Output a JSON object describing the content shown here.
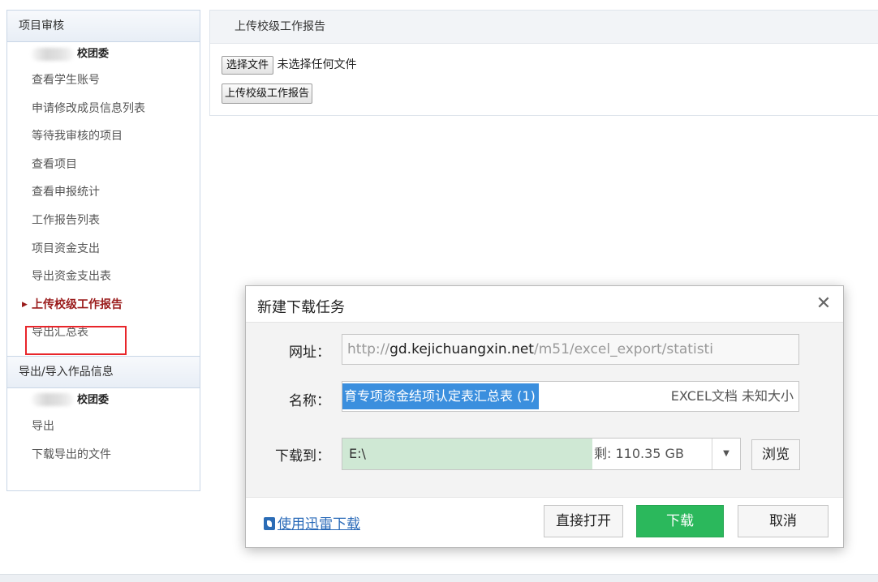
{
  "sidebar": {
    "section1_title": "项目审核",
    "org1_suffix": "校团委",
    "items": [
      "查看学生账号",
      "申请修改成员信息列表",
      "等待我审核的项目",
      "查看项目",
      "查看申报统计",
      "工作报告列表",
      "项目资金支出",
      "导出资金支出表",
      "上传校级工作报告",
      "导出汇总表"
    ],
    "active_arrow": "▶",
    "section2_title": "导出/导入作品信息",
    "org2_suffix": "校团委",
    "items2": [
      "导出",
      "下载导出的文件"
    ]
  },
  "panel": {
    "title": "上传校级工作报告",
    "choose_file_label": "选择文件",
    "no_file_text": "未选择任何文件",
    "upload_button": "上传校级工作报告"
  },
  "dialog": {
    "title": "新建下载任务",
    "close_glyph": "✕",
    "url_label": "网址：",
    "url_prefix": "http://",
    "url_host": "gd.kejichuangxin.net",
    "url_path": "/m51/excel_export/statisti",
    "name_label": "名称：",
    "name_value": "育专项资金结项认定表汇总表 (1)",
    "name_type": "EXCEL文档 未知大小",
    "dest_label": "下载到：",
    "dest_path": "E:\\",
    "dest_free": "剩: 110.35 GB",
    "dropdown_glyph": "▼",
    "browse": "浏览",
    "xunlei_link": "使用迅雷下载",
    "open_button": "直接打开",
    "download_button": "下载",
    "cancel_button": "取消"
  },
  "colors": {
    "active_red": "#9a1b1b",
    "highlight_box": "#e8252a",
    "download_green": "#2bb85c",
    "selection_blue": "#3b8fde",
    "disk_fill": "#cfe8d4"
  }
}
